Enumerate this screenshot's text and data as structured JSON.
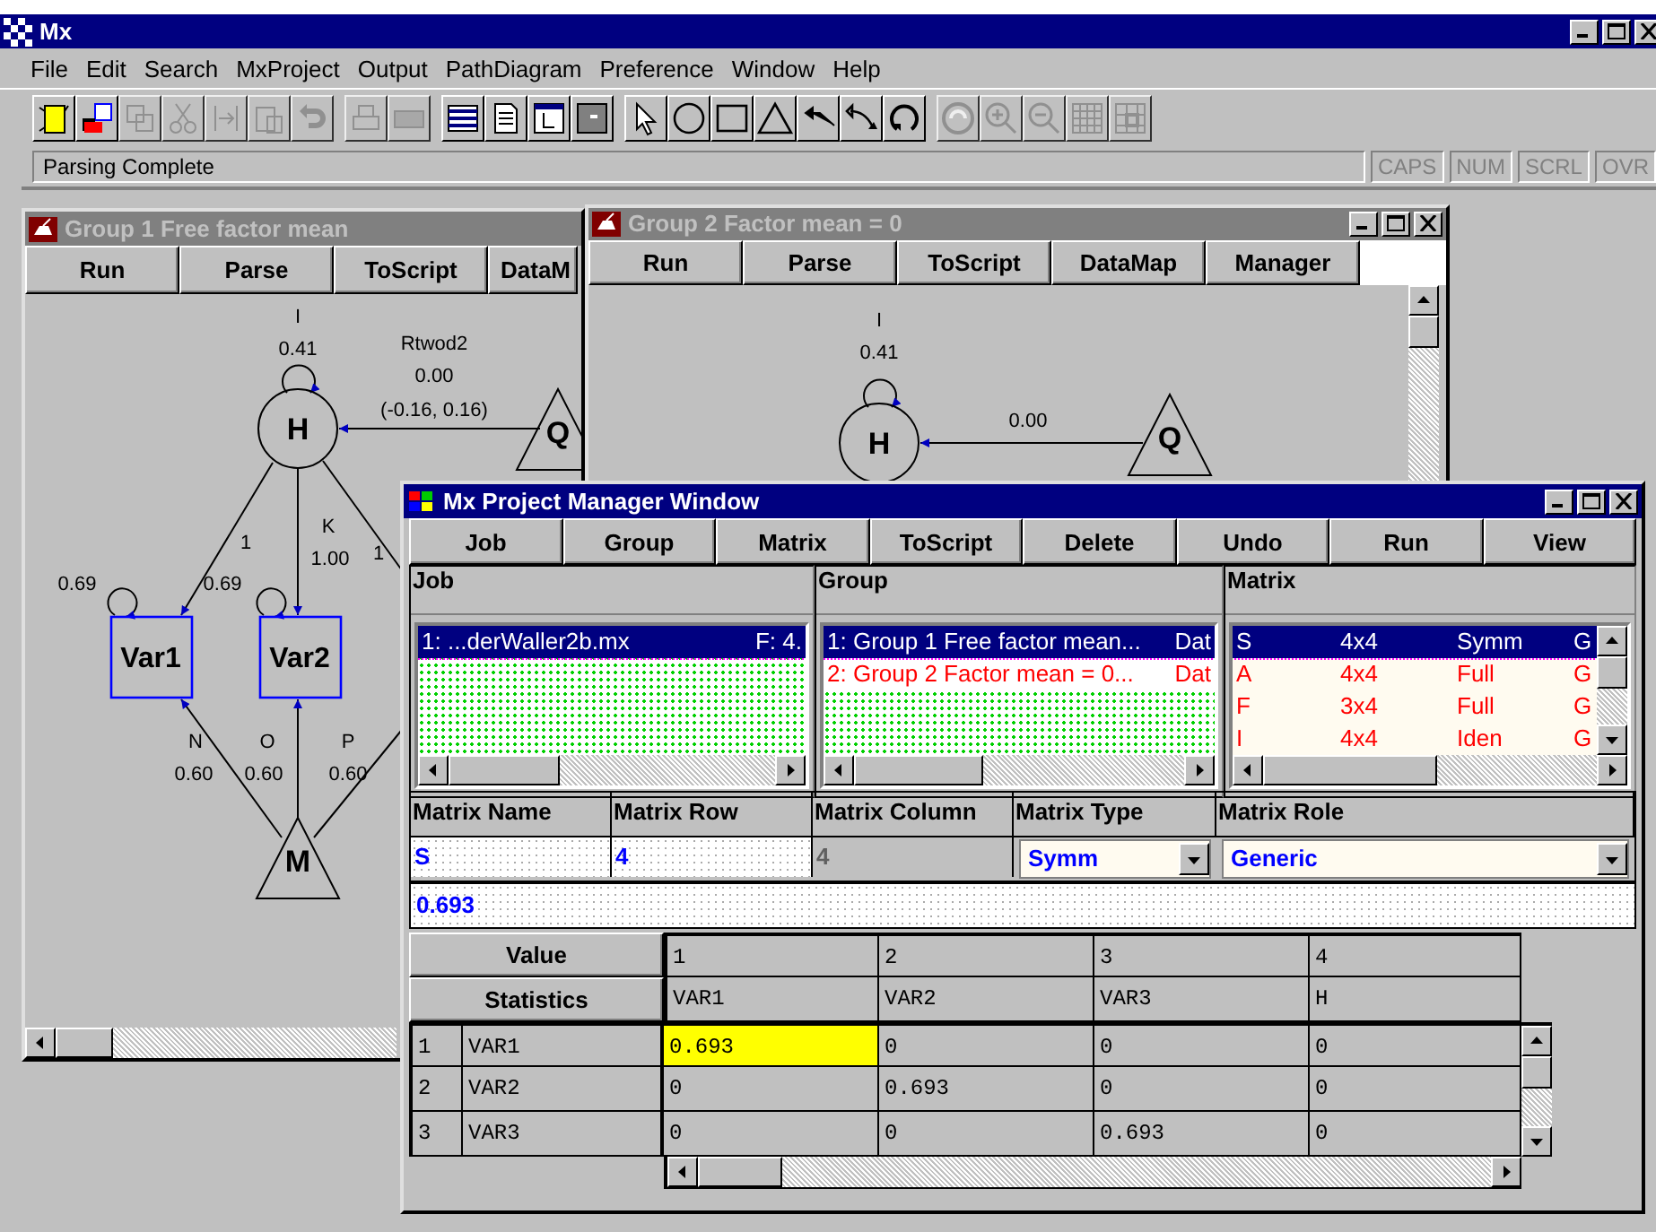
{
  "window": {
    "title": "Mx"
  },
  "menu": [
    "File",
    "Edit",
    "Search",
    "MxProject",
    "Output",
    "PathDiagram",
    "Preference",
    "Window",
    "Help"
  ],
  "toolbar": [
    {
      "kind": "new",
      "disabled": false
    },
    {
      "kind": "open",
      "disabled": false
    },
    {
      "kind": "save",
      "disabled": true
    },
    {
      "kind": "cut",
      "disabled": true
    },
    {
      "kind": "transfer",
      "disabled": true
    },
    {
      "kind": "paste",
      "disabled": true
    },
    {
      "kind": "undo",
      "disabled": true
    },
    {
      "kind": "print",
      "disabled": true
    },
    {
      "kind": "keyboard",
      "disabled": true
    },
    {
      "kind": "dataview",
      "disabled": false
    },
    {
      "kind": "document",
      "disabled": false
    },
    {
      "kind": "diagram",
      "disabled": false
    },
    {
      "kind": "blank",
      "disabled": false
    },
    {
      "kind": "pointer",
      "disabled": false
    },
    {
      "kind": "circle",
      "disabled": false
    },
    {
      "kind": "square",
      "disabled": false
    },
    {
      "kind": "triangle",
      "disabled": false
    },
    {
      "kind": "line-arrow",
      "disabled": false
    },
    {
      "kind": "curve-arrow",
      "disabled": false
    },
    {
      "kind": "loop",
      "disabled": false
    },
    {
      "kind": "refresh",
      "disabled": true
    },
    {
      "kind": "zoom-in",
      "disabled": true
    },
    {
      "kind": "zoom-out",
      "disabled": true
    },
    {
      "kind": "grid",
      "disabled": true
    },
    {
      "kind": "grid-select",
      "disabled": true
    }
  ],
  "status_bar": {
    "message": "Parsing Complete",
    "indicators": [
      {
        "label": "CAPS",
        "disabled": true
      },
      {
        "label": "NUM",
        "disabled": true
      },
      {
        "label": "SCRL",
        "disabled": true
      },
      {
        "label": "OVR",
        "disabled": true
      }
    ]
  },
  "group_windows": [
    {
      "title": "Group 1 Free factor mean",
      "active": false,
      "buttons": [
        "Run",
        "Parse",
        "ToScript",
        "DataM"
      ],
      "diagram": {
        "nodes": [
          {
            "kind": "latent",
            "label": "H"
          },
          {
            "kind": "manifest",
            "label": "Var1"
          },
          {
            "kind": "manifest",
            "label": "Var2"
          },
          {
            "kind": "mean",
            "label": "M"
          },
          {
            "kind": "mean",
            "label": "Q"
          }
        ],
        "labels": [
          "I",
          "0.41",
          "Rtwod2",
          "0.00",
          "(-0.16, 0.16)",
          "1",
          "0.69",
          "K",
          "1.00",
          "1",
          "0.69",
          "N",
          "0.60",
          "O",
          "0.60",
          "P",
          "0.60"
        ]
      }
    },
    {
      "title": "Group 2 Factor mean = 0",
      "active": false,
      "buttons": [
        "Run",
        "Parse",
        "ToScript",
        "DataMap",
        "Manager"
      ],
      "diagram": {
        "nodes": [
          {
            "kind": "latent",
            "label": "H"
          },
          {
            "kind": "mean",
            "label": "Q"
          }
        ],
        "labels": [
          "I",
          "0.41",
          "0.00"
        ]
      }
    }
  ],
  "project_manager": {
    "title": "Mx Project Manager Window",
    "active": true,
    "buttons": [
      "Job",
      "Group",
      "Matrix",
      "ToScript",
      "Delete",
      "Undo",
      "Run",
      "View"
    ],
    "job_panel": {
      "header": "Job",
      "items": [
        {
          "name": "1: ...derWaller2b.mx",
          "status": "F: 4.",
          "selected": true
        }
      ]
    },
    "group_panel": {
      "header": "Group",
      "items": [
        {
          "name": "1: Group 1 Free factor mean...",
          "data": "Dat",
          "selected": true
        },
        {
          "name": "2: Group 2 Factor mean = 0...",
          "data": "Dat",
          "selected": false
        }
      ]
    },
    "matrix_panel": {
      "header": "Matrix",
      "items": [
        {
          "name": "S",
          "size": "4x4",
          "type": "Symm",
          "role": "G",
          "selected": true
        },
        {
          "name": "A",
          "size": "4x4",
          "type": "Full",
          "role": "G",
          "selected": false
        },
        {
          "name": "F",
          "size": "3x4",
          "type": "Full",
          "role": "G",
          "selected": false
        },
        {
          "name": "I",
          "size": "4x4",
          "type": "Iden",
          "role": "G",
          "selected": false
        }
      ]
    },
    "fields": [
      {
        "label": "Matrix Name",
        "value": "S",
        "kind": "text",
        "disabled": false
      },
      {
        "label": "Matrix Row",
        "value": "4",
        "kind": "text",
        "disabled": false
      },
      {
        "label": "Matrix Column",
        "value": "4",
        "kind": "text",
        "disabled": true
      },
      {
        "label": "Matrix Type",
        "value": "Symm",
        "kind": "dropdown",
        "disabled": false
      },
      {
        "label": "Matrix Role",
        "value": "Generic",
        "kind": "dropdown",
        "disabled": false
      }
    ],
    "value_field": {
      "value": "0.693"
    },
    "view_buttons": [
      "Value",
      "Statistics"
    ],
    "grid": {
      "columns": [
        {
          "index": "1",
          "name": "VAR1"
        },
        {
          "index": "2",
          "name": "VAR2"
        },
        {
          "index": "3",
          "name": "VAR3"
        },
        {
          "index": "4",
          "name": "H"
        }
      ],
      "rows": [
        {
          "index": "1",
          "name": "VAR1",
          "cells": [
            {
              "value": "0.693",
              "selected": true
            },
            {
              "value": "0",
              "selected": false
            },
            {
              "value": "0",
              "selected": false
            },
            {
              "value": "0",
              "selected": false
            }
          ]
        },
        {
          "index": "2",
          "name": "VAR2",
          "cells": [
            {
              "value": "0",
              "selected": false
            },
            {
              "value": "0.693",
              "selected": false
            },
            {
              "value": "0",
              "selected": false
            },
            {
              "value": "0",
              "selected": false
            }
          ]
        },
        {
          "index": "3",
          "name": "VAR3",
          "cells": [
            {
              "value": "0",
              "selected": false
            },
            {
              "value": "0",
              "selected": false
            },
            {
              "value": "0.693",
              "selected": false
            },
            {
              "value": "0",
              "selected": false
            }
          ]
        }
      ]
    }
  }
}
